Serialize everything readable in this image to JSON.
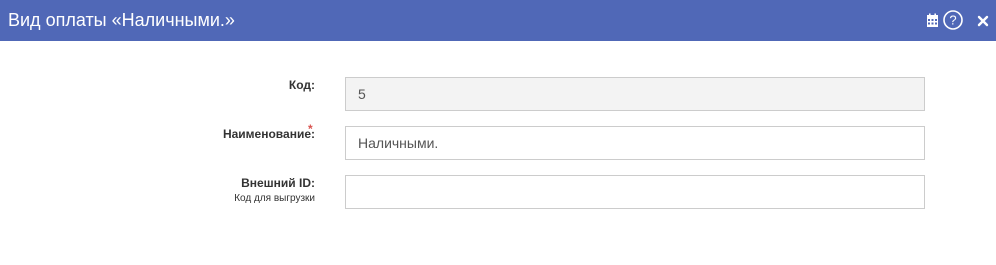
{
  "window": {
    "title": "Вид оплаты «Наличными.»",
    "header_color": "#5068b7",
    "icons": [
      "calendar-icon",
      "help-icon",
      "close-icon"
    ]
  },
  "form": {
    "code": {
      "label": "Код:",
      "value": "5"
    },
    "name": {
      "label": "Наименование:",
      "required_mark": "*",
      "value": "Наличными."
    },
    "external_id": {
      "label": "Внешний ID:",
      "sublabel": "Код для выгрузки",
      "value": ""
    }
  }
}
